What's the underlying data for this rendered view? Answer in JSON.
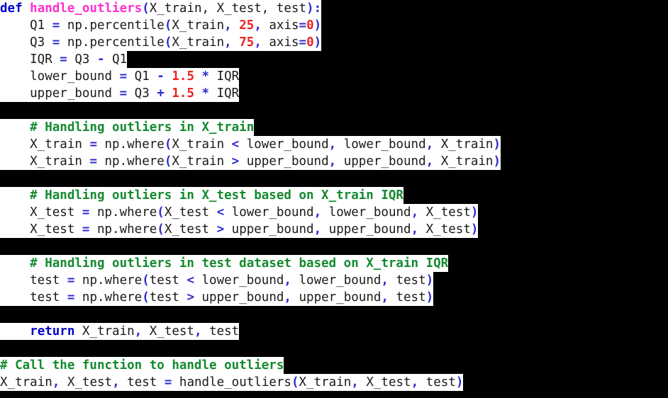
{
  "code": {
    "language": "python",
    "background_color": "#000000",
    "line_background_color": "#ffffff",
    "colors": {
      "keyword": "#0000cd",
      "function_name": "#ff2fd0",
      "comment": "#138a2e",
      "number": "#ee2222",
      "operator": "#2a2acc",
      "identifier": "#1a1a1a"
    },
    "lines": [
      {
        "index": 1,
        "text": "def handle_outliers(X_train, X_test, test):",
        "tokens": [
          {
            "t": "def",
            "c": "kw"
          },
          {
            "t": " ",
            "c": "plain"
          },
          {
            "t": "handle_outliers",
            "c": "fn"
          },
          {
            "t": "(",
            "c": "punc"
          },
          {
            "t": "X_train, X_test, test",
            "c": "id"
          },
          {
            "t": ")",
            "c": "punc"
          },
          {
            "t": ":",
            "c": "punc"
          }
        ]
      },
      {
        "index": 2,
        "text": "    Q1 = np.percentile(X_train, 25, axis=0)",
        "tokens": [
          {
            "t": "    Q1 ",
            "c": "id"
          },
          {
            "t": "=",
            "c": "op"
          },
          {
            "t": " np.percentile",
            "c": "id"
          },
          {
            "t": "(",
            "c": "punc"
          },
          {
            "t": "X_train",
            "c": "id"
          },
          {
            "t": ",",
            "c": "punc"
          },
          {
            "t": " ",
            "c": "plain"
          },
          {
            "t": "25",
            "c": "num"
          },
          {
            "t": ",",
            "c": "punc"
          },
          {
            "t": " axis",
            "c": "id"
          },
          {
            "t": "=",
            "c": "op"
          },
          {
            "t": "0",
            "c": "num"
          },
          {
            "t": ")",
            "c": "punc"
          }
        ]
      },
      {
        "index": 3,
        "text": "    Q3 = np.percentile(X_train, 75, axis=0)",
        "tokens": [
          {
            "t": "    Q3 ",
            "c": "id"
          },
          {
            "t": "=",
            "c": "op"
          },
          {
            "t": " np.percentile",
            "c": "id"
          },
          {
            "t": "(",
            "c": "punc"
          },
          {
            "t": "X_train",
            "c": "id"
          },
          {
            "t": ",",
            "c": "punc"
          },
          {
            "t": " ",
            "c": "plain"
          },
          {
            "t": "75",
            "c": "num"
          },
          {
            "t": ",",
            "c": "punc"
          },
          {
            "t": " axis",
            "c": "id"
          },
          {
            "t": "=",
            "c": "op"
          },
          {
            "t": "0",
            "c": "num"
          },
          {
            "t": ")",
            "c": "punc"
          }
        ]
      },
      {
        "index": 4,
        "text": "    IQR = Q3 - Q1",
        "tokens": [
          {
            "t": "    IQR ",
            "c": "id"
          },
          {
            "t": "=",
            "c": "op"
          },
          {
            "t": " Q3 ",
            "c": "id"
          },
          {
            "t": "-",
            "c": "op"
          },
          {
            "t": " Q1",
            "c": "id"
          }
        ]
      },
      {
        "index": 5,
        "text": "    lower_bound = Q1 - 1.5 * IQR",
        "tokens": [
          {
            "t": "    lower_bound ",
            "c": "id"
          },
          {
            "t": "=",
            "c": "op"
          },
          {
            "t": " Q1 ",
            "c": "id"
          },
          {
            "t": "-",
            "c": "op"
          },
          {
            "t": " ",
            "c": "plain"
          },
          {
            "t": "1.5",
            "c": "num"
          },
          {
            "t": " ",
            "c": "plain"
          },
          {
            "t": "*",
            "c": "op"
          },
          {
            "t": " IQR",
            "c": "id"
          }
        ]
      },
      {
        "index": 6,
        "text": "    upper_bound = Q3 + 1.5 * IQR",
        "tokens": [
          {
            "t": "    upper_bound ",
            "c": "id"
          },
          {
            "t": "=",
            "c": "op"
          },
          {
            "t": " Q3 ",
            "c": "id"
          },
          {
            "t": "+",
            "c": "op"
          },
          {
            "t": " ",
            "c": "plain"
          },
          {
            "t": "1.5",
            "c": "num"
          },
          {
            "t": " ",
            "c": "plain"
          },
          {
            "t": "*",
            "c": "op"
          },
          {
            "t": " IQR",
            "c": "id"
          }
        ]
      },
      {
        "index": 7,
        "text": "",
        "blank": true,
        "tokens": []
      },
      {
        "index": 8,
        "text": "    # Handling outliers in X_train",
        "tokens": [
          {
            "t": "    ",
            "c": "plain"
          },
          {
            "t": "# Handling outliers in X_train",
            "c": "cmt"
          }
        ]
      },
      {
        "index": 9,
        "text": "    X_train = np.where(X_train < lower_bound, lower_bound, X_train)",
        "tokens": [
          {
            "t": "    X_train ",
            "c": "id"
          },
          {
            "t": "=",
            "c": "op"
          },
          {
            "t": " np.where",
            "c": "id"
          },
          {
            "t": "(",
            "c": "punc"
          },
          {
            "t": "X_train ",
            "c": "id"
          },
          {
            "t": "<",
            "c": "op"
          },
          {
            "t": " lower_bound",
            "c": "id"
          },
          {
            "t": ",",
            "c": "punc"
          },
          {
            "t": " lower_bound",
            "c": "id"
          },
          {
            "t": ",",
            "c": "punc"
          },
          {
            "t": " X_train",
            "c": "id"
          },
          {
            "t": ")",
            "c": "punc"
          }
        ]
      },
      {
        "index": 10,
        "text": "    X_train = np.where(X_train > upper_bound, upper_bound, X_train)",
        "tokens": [
          {
            "t": "    X_train ",
            "c": "id"
          },
          {
            "t": "=",
            "c": "op"
          },
          {
            "t": " np.where",
            "c": "id"
          },
          {
            "t": "(",
            "c": "punc"
          },
          {
            "t": "X_train ",
            "c": "id"
          },
          {
            "t": ">",
            "c": "op"
          },
          {
            "t": " upper_bound",
            "c": "id"
          },
          {
            "t": ",",
            "c": "punc"
          },
          {
            "t": " upper_bound",
            "c": "id"
          },
          {
            "t": ",",
            "c": "punc"
          },
          {
            "t": " X_train",
            "c": "id"
          },
          {
            "t": ")",
            "c": "punc"
          }
        ]
      },
      {
        "index": 11,
        "text": "",
        "blank": true,
        "tokens": []
      },
      {
        "index": 12,
        "text": "    # Handling outliers in X_test based on X_train IQR",
        "tokens": [
          {
            "t": "    ",
            "c": "plain"
          },
          {
            "t": "# Handling outliers in X_test based on X_train IQR",
            "c": "cmt"
          }
        ]
      },
      {
        "index": 13,
        "text": "    X_test = np.where(X_test < lower_bound, lower_bound, X_test)",
        "tokens": [
          {
            "t": "    X_test ",
            "c": "id"
          },
          {
            "t": "=",
            "c": "op"
          },
          {
            "t": " np.where",
            "c": "id"
          },
          {
            "t": "(",
            "c": "punc"
          },
          {
            "t": "X_test ",
            "c": "id"
          },
          {
            "t": "<",
            "c": "op"
          },
          {
            "t": " lower_bound",
            "c": "id"
          },
          {
            "t": ",",
            "c": "punc"
          },
          {
            "t": " lower_bound",
            "c": "id"
          },
          {
            "t": ",",
            "c": "punc"
          },
          {
            "t": " X_test",
            "c": "id"
          },
          {
            "t": ")",
            "c": "punc"
          }
        ]
      },
      {
        "index": 14,
        "text": "    X_test = np.where(X_test > upper_bound, upper_bound, X_test)",
        "tokens": [
          {
            "t": "    X_test ",
            "c": "id"
          },
          {
            "t": "=",
            "c": "op"
          },
          {
            "t": " np.where",
            "c": "id"
          },
          {
            "t": "(",
            "c": "punc"
          },
          {
            "t": "X_test ",
            "c": "id"
          },
          {
            "t": ">",
            "c": "op"
          },
          {
            "t": " upper_bound",
            "c": "id"
          },
          {
            "t": ",",
            "c": "punc"
          },
          {
            "t": " upper_bound",
            "c": "id"
          },
          {
            "t": ",",
            "c": "punc"
          },
          {
            "t": " X_test",
            "c": "id"
          },
          {
            "t": ")",
            "c": "punc"
          }
        ]
      },
      {
        "index": 15,
        "text": "",
        "blank": true,
        "tokens": []
      },
      {
        "index": 16,
        "text": "    # Handling outliers in test dataset based on X_train IQR",
        "tokens": [
          {
            "t": "    ",
            "c": "plain"
          },
          {
            "t": "# Handling outliers in test dataset based on X_train IQR",
            "c": "cmt"
          }
        ]
      },
      {
        "index": 17,
        "text": "    test = np.where(test < lower_bound, lower_bound, test)",
        "tokens": [
          {
            "t": "    test ",
            "c": "id"
          },
          {
            "t": "=",
            "c": "op"
          },
          {
            "t": " np.where",
            "c": "id"
          },
          {
            "t": "(",
            "c": "punc"
          },
          {
            "t": "test ",
            "c": "id"
          },
          {
            "t": "<",
            "c": "op"
          },
          {
            "t": " lower_bound",
            "c": "id"
          },
          {
            "t": ",",
            "c": "punc"
          },
          {
            "t": " lower_bound",
            "c": "id"
          },
          {
            "t": ",",
            "c": "punc"
          },
          {
            "t": " test",
            "c": "id"
          },
          {
            "t": ")",
            "c": "punc"
          }
        ]
      },
      {
        "index": 18,
        "text": "    test = np.where(test > upper_bound, upper_bound, test)",
        "tokens": [
          {
            "t": "    test ",
            "c": "id"
          },
          {
            "t": "=",
            "c": "op"
          },
          {
            "t": " np.where",
            "c": "id"
          },
          {
            "t": "(",
            "c": "punc"
          },
          {
            "t": "test ",
            "c": "id"
          },
          {
            "t": ">",
            "c": "op"
          },
          {
            "t": " upper_bound",
            "c": "id"
          },
          {
            "t": ",",
            "c": "punc"
          },
          {
            "t": " upper_bound",
            "c": "id"
          },
          {
            "t": ",",
            "c": "punc"
          },
          {
            "t": " test",
            "c": "id"
          },
          {
            "t": ")",
            "c": "punc"
          }
        ]
      },
      {
        "index": 19,
        "text": "",
        "blank": true,
        "tokens": []
      },
      {
        "index": 20,
        "text": "    return X_train, X_test, test",
        "tokens": [
          {
            "t": "    ",
            "c": "plain"
          },
          {
            "t": "return",
            "c": "kw"
          },
          {
            "t": " X_train",
            "c": "id"
          },
          {
            "t": ",",
            "c": "punc"
          },
          {
            "t": " X_test",
            "c": "id"
          },
          {
            "t": ",",
            "c": "punc"
          },
          {
            "t": " test",
            "c": "id"
          }
        ]
      },
      {
        "index": 21,
        "text": "",
        "blank": true,
        "tokens": []
      },
      {
        "index": 22,
        "text": "# Call the function to handle outliers",
        "tokens": [
          {
            "t": "# Call the function to handle outliers",
            "c": "cmt"
          }
        ]
      },
      {
        "index": 23,
        "text": "X_train, X_test, test = handle_outliers(X_train, X_test, test)",
        "tokens": [
          {
            "t": "X_train",
            "c": "id"
          },
          {
            "t": ",",
            "c": "punc"
          },
          {
            "t": " X_test",
            "c": "id"
          },
          {
            "t": ",",
            "c": "punc"
          },
          {
            "t": " test ",
            "c": "id"
          },
          {
            "t": "=",
            "c": "op"
          },
          {
            "t": " handle_outliers",
            "c": "id"
          },
          {
            "t": "(",
            "c": "punc"
          },
          {
            "t": "X_train",
            "c": "id"
          },
          {
            "t": ",",
            "c": "punc"
          },
          {
            "t": " X_test",
            "c": "id"
          },
          {
            "t": ",",
            "c": "punc"
          },
          {
            "t": " test",
            "c": "id"
          },
          {
            "t": ")",
            "c": "punc"
          }
        ]
      }
    ]
  }
}
